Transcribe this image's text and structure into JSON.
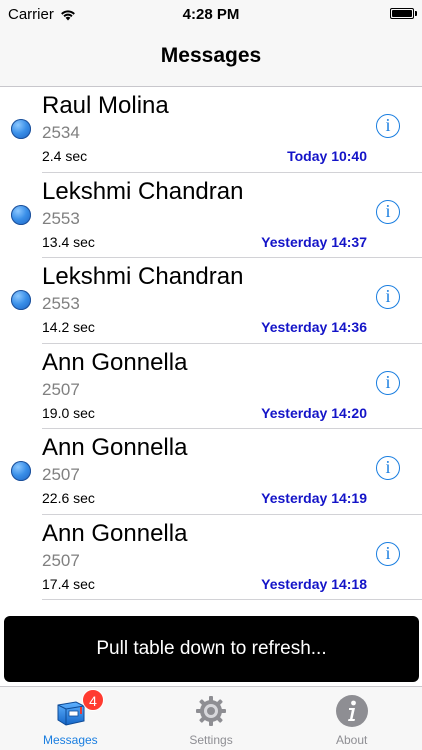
{
  "status_bar": {
    "carrier": "Carrier",
    "time": "4:28 PM"
  },
  "nav": {
    "title": "Messages"
  },
  "messages": [
    {
      "name": "Raul Molina",
      "extension": "2534",
      "duration": "2.4 sec",
      "time": "Today 10:40",
      "unread": true
    },
    {
      "name": "Lekshmi Chandran",
      "extension": "2553",
      "duration": "13.4 sec",
      "time": "Yesterday 14:37",
      "unread": true
    },
    {
      "name": "Lekshmi Chandran",
      "extension": "2553",
      "duration": "14.2 sec",
      "time": "Yesterday 14:36",
      "unread": true
    },
    {
      "name": "Ann Gonnella",
      "extension": "2507",
      "duration": "19.0 sec",
      "time": "Yesterday 14:20",
      "unread": false
    },
    {
      "name": "Ann Gonnella",
      "extension": "2507",
      "duration": "22.6 sec",
      "time": "Yesterday 14:19",
      "unread": true
    },
    {
      "name": "Ann Gonnella",
      "extension": "2507",
      "duration": "17.4 sec",
      "time": "Yesterday 14:18",
      "unread": false
    }
  ],
  "info_icon_glyph": "i",
  "toast": {
    "text": "Pull table down to refresh..."
  },
  "tabs": [
    {
      "label": "Messages",
      "icon": "voicemail-icon",
      "badge": "4",
      "active": true
    },
    {
      "label": "Settings",
      "icon": "gear-icon",
      "active": false
    },
    {
      "label": "About",
      "icon": "info-icon",
      "active": false
    }
  ],
  "colors": {
    "accent": "#1a7ee0",
    "time_text": "#1414c8",
    "badge": "#ff3b30",
    "unread_dot": "#3a8fe8"
  }
}
